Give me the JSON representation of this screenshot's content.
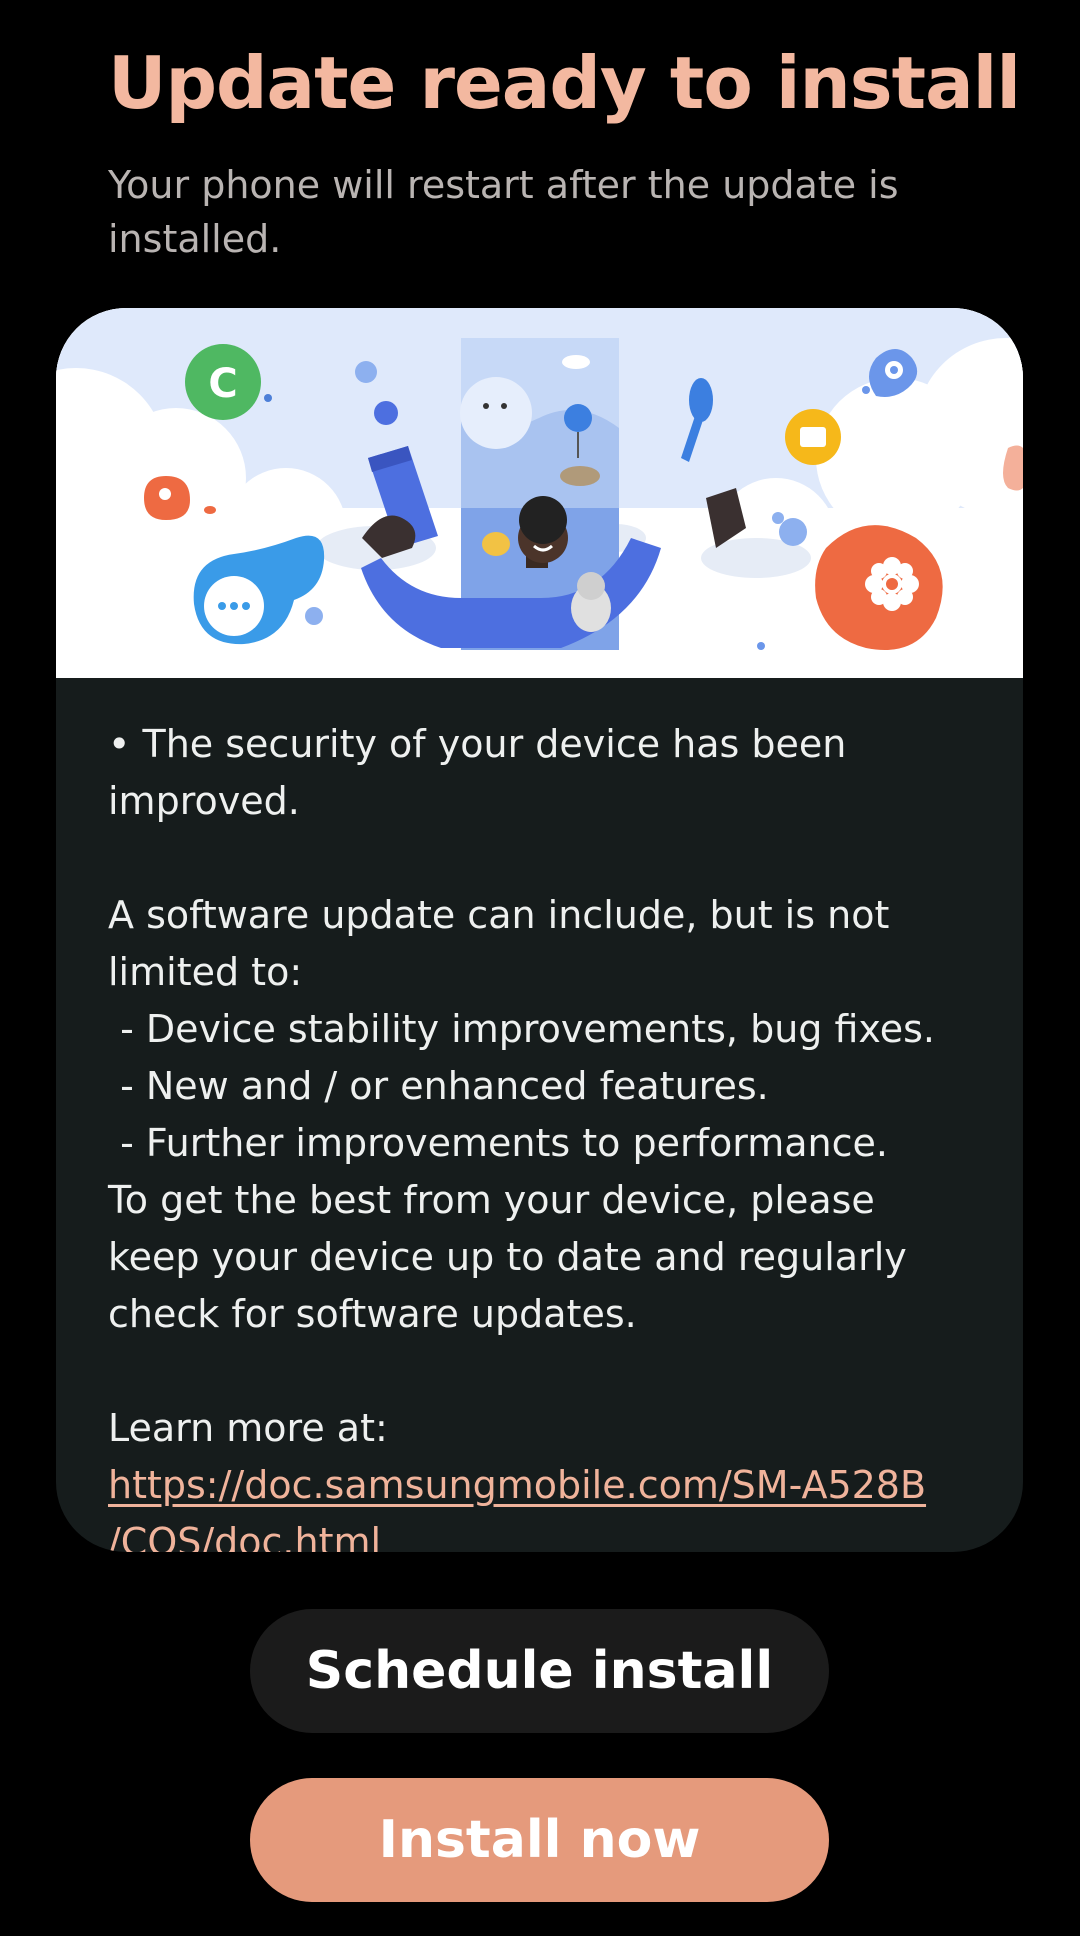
{
  "header": {
    "title": "Update ready to install",
    "subtitle": "Your phone will restart after the update is installed."
  },
  "release_notes": {
    "line1": "• The security of your device has been",
    "line2": "improved.",
    "line3": "A software update can include, but is not",
    "line4": "limited to:",
    "line5": " - Device stability improvements, bug fixes.",
    "line6": " - New and / or enhanced features.",
    "line7": " - Further improvements to performance.",
    "line8": "To get the best from your device, please",
    "line9": "keep your device up to date and regularly",
    "line10": "check for software updates.",
    "line11": "Learn more at:",
    "link_line1": "https://doc.samsungmobile.com/SM-A528B",
    "link_line2": "/COS/doc.html"
  },
  "actions": {
    "schedule_label": "Schedule install",
    "install_label": "Install now"
  },
  "colors": {
    "title": "#f3b8a0",
    "primary_button": "#e59a7c",
    "secondary_button": "#1b1b1b",
    "card_background": "#161c1c",
    "link": "#f0b39b"
  },
  "illustration": {
    "icons": [
      "phone-icon",
      "chat-icon",
      "folder-icon",
      "settings-icon",
      "flower-icon",
      "person-icon"
    ]
  }
}
